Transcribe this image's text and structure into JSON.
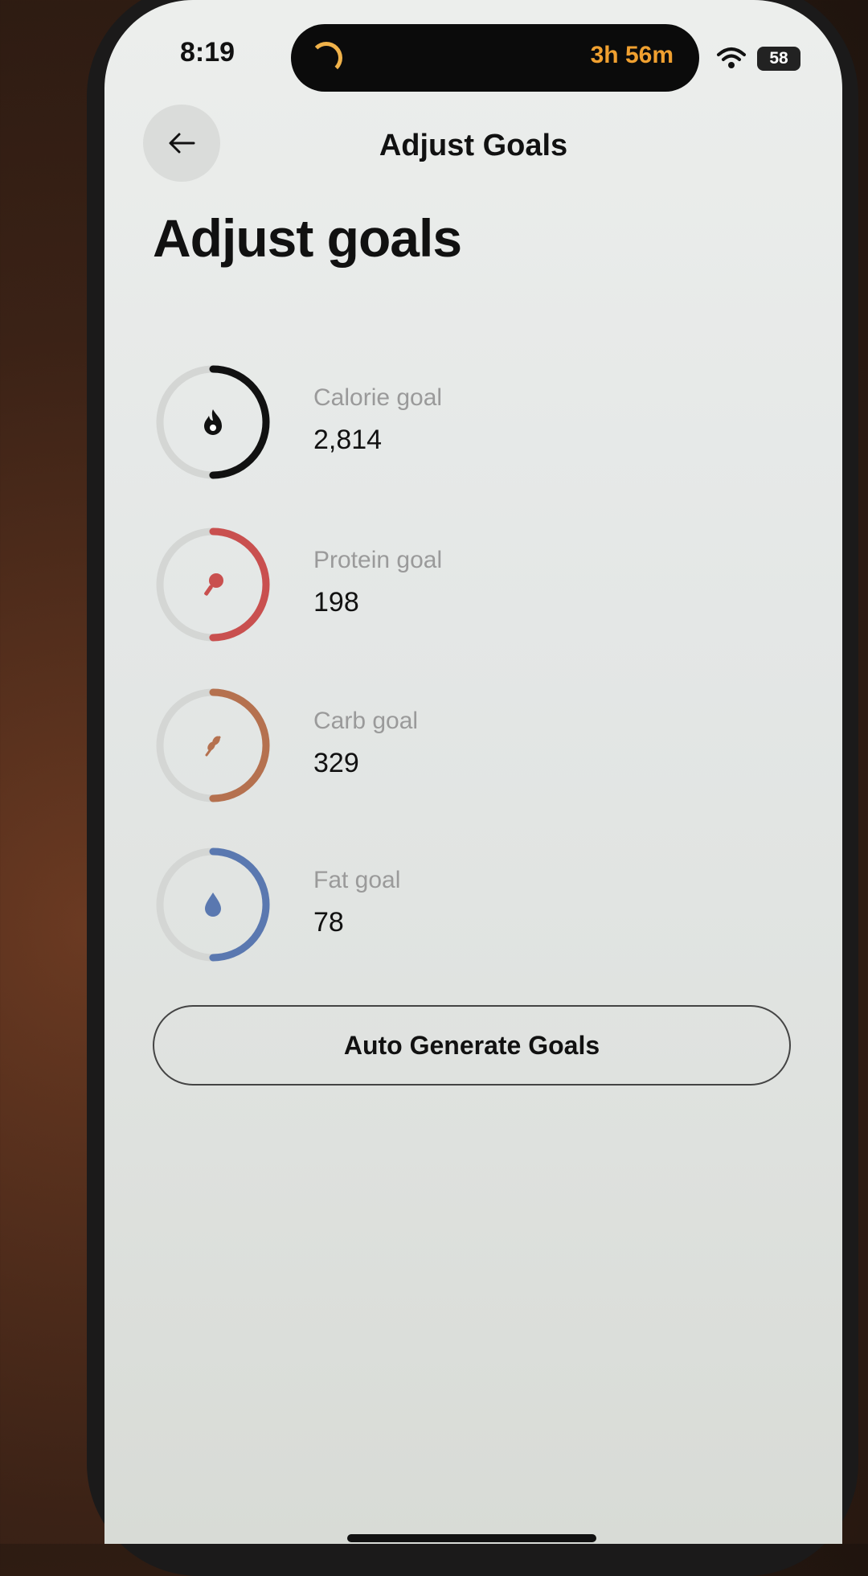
{
  "status_bar": {
    "time": "8:19",
    "timer": "3h 56m",
    "battery": "58"
  },
  "header": {
    "title": "Adjust Goals"
  },
  "page_title": "Adjust goals",
  "goals": [
    {
      "label": "Calorie goal",
      "value": "2,814",
      "color": "#111111",
      "icon": "flame-icon",
      "progress": 0.5
    },
    {
      "label": "Protein goal",
      "value": "198",
      "color": "#c9504f",
      "icon": "drumstick-icon",
      "progress": 0.5
    },
    {
      "label": "Carb goal",
      "value": "329",
      "color": "#b5714f",
      "icon": "wheat-icon",
      "progress": 0.5
    },
    {
      "label": "Fat goal",
      "value": "78",
      "color": "#5a78b0",
      "icon": "droplet-icon",
      "progress": 0.5
    }
  ],
  "auto_button": {
    "label": "Auto Generate Goals"
  }
}
